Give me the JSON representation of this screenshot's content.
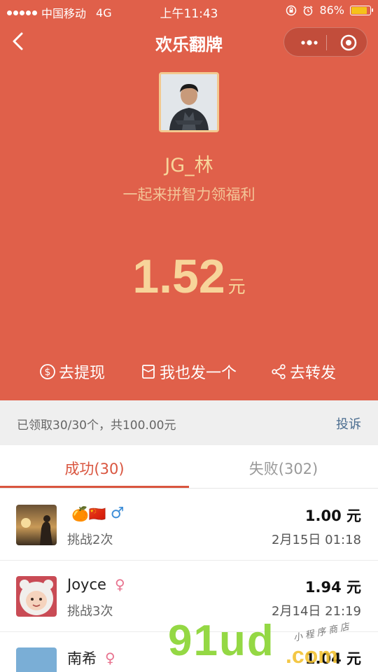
{
  "status_bar": {
    "carrier": "中国移动",
    "network": "4G",
    "time": "上午11:43",
    "battery": "86%",
    "battery_level": 0.86
  },
  "nav": {
    "title": "欢乐翻牌"
  },
  "profile": {
    "name": "JG_林",
    "slogan": "一起来拼智力领福利"
  },
  "amount": {
    "value": "1.52",
    "unit": "元"
  },
  "actions": [
    {
      "label": "去提现",
      "icon": "dollar-circle-icon"
    },
    {
      "label": "我也发一个",
      "icon": "envelope-icon"
    },
    {
      "label": "去转发",
      "icon": "share-icon"
    }
  ],
  "summary": {
    "text": "已领取30/30个，共100.00元",
    "complain": "投诉"
  },
  "tabs": [
    {
      "label": "成功(30)",
      "active": true
    },
    {
      "label": "失败(302)",
      "active": false
    }
  ],
  "records": [
    {
      "name": "",
      "emoji": "🍊🇨🇳",
      "gender": "♂",
      "sub": "挑战2次",
      "amount": "1.00 元",
      "date": "2月15日 01:18"
    },
    {
      "name": "Joyce",
      "emoji": "",
      "gender": "♀",
      "sub": "挑战3次",
      "amount": "1.94 元",
      "date": "2月14日 21:19"
    },
    {
      "name": "南希",
      "emoji": "",
      "gender": "♀",
      "sub": "",
      "amount": "1.04 元",
      "date": ""
    }
  ],
  "watermark": {
    "main": "91ud",
    "suffix": ".com",
    "tag": "小程序商店"
  },
  "colors": {
    "primary": "#e0604a",
    "gold": "#f7d49a",
    "tab_active": "#d9553f",
    "link": "#4a6c8f"
  }
}
